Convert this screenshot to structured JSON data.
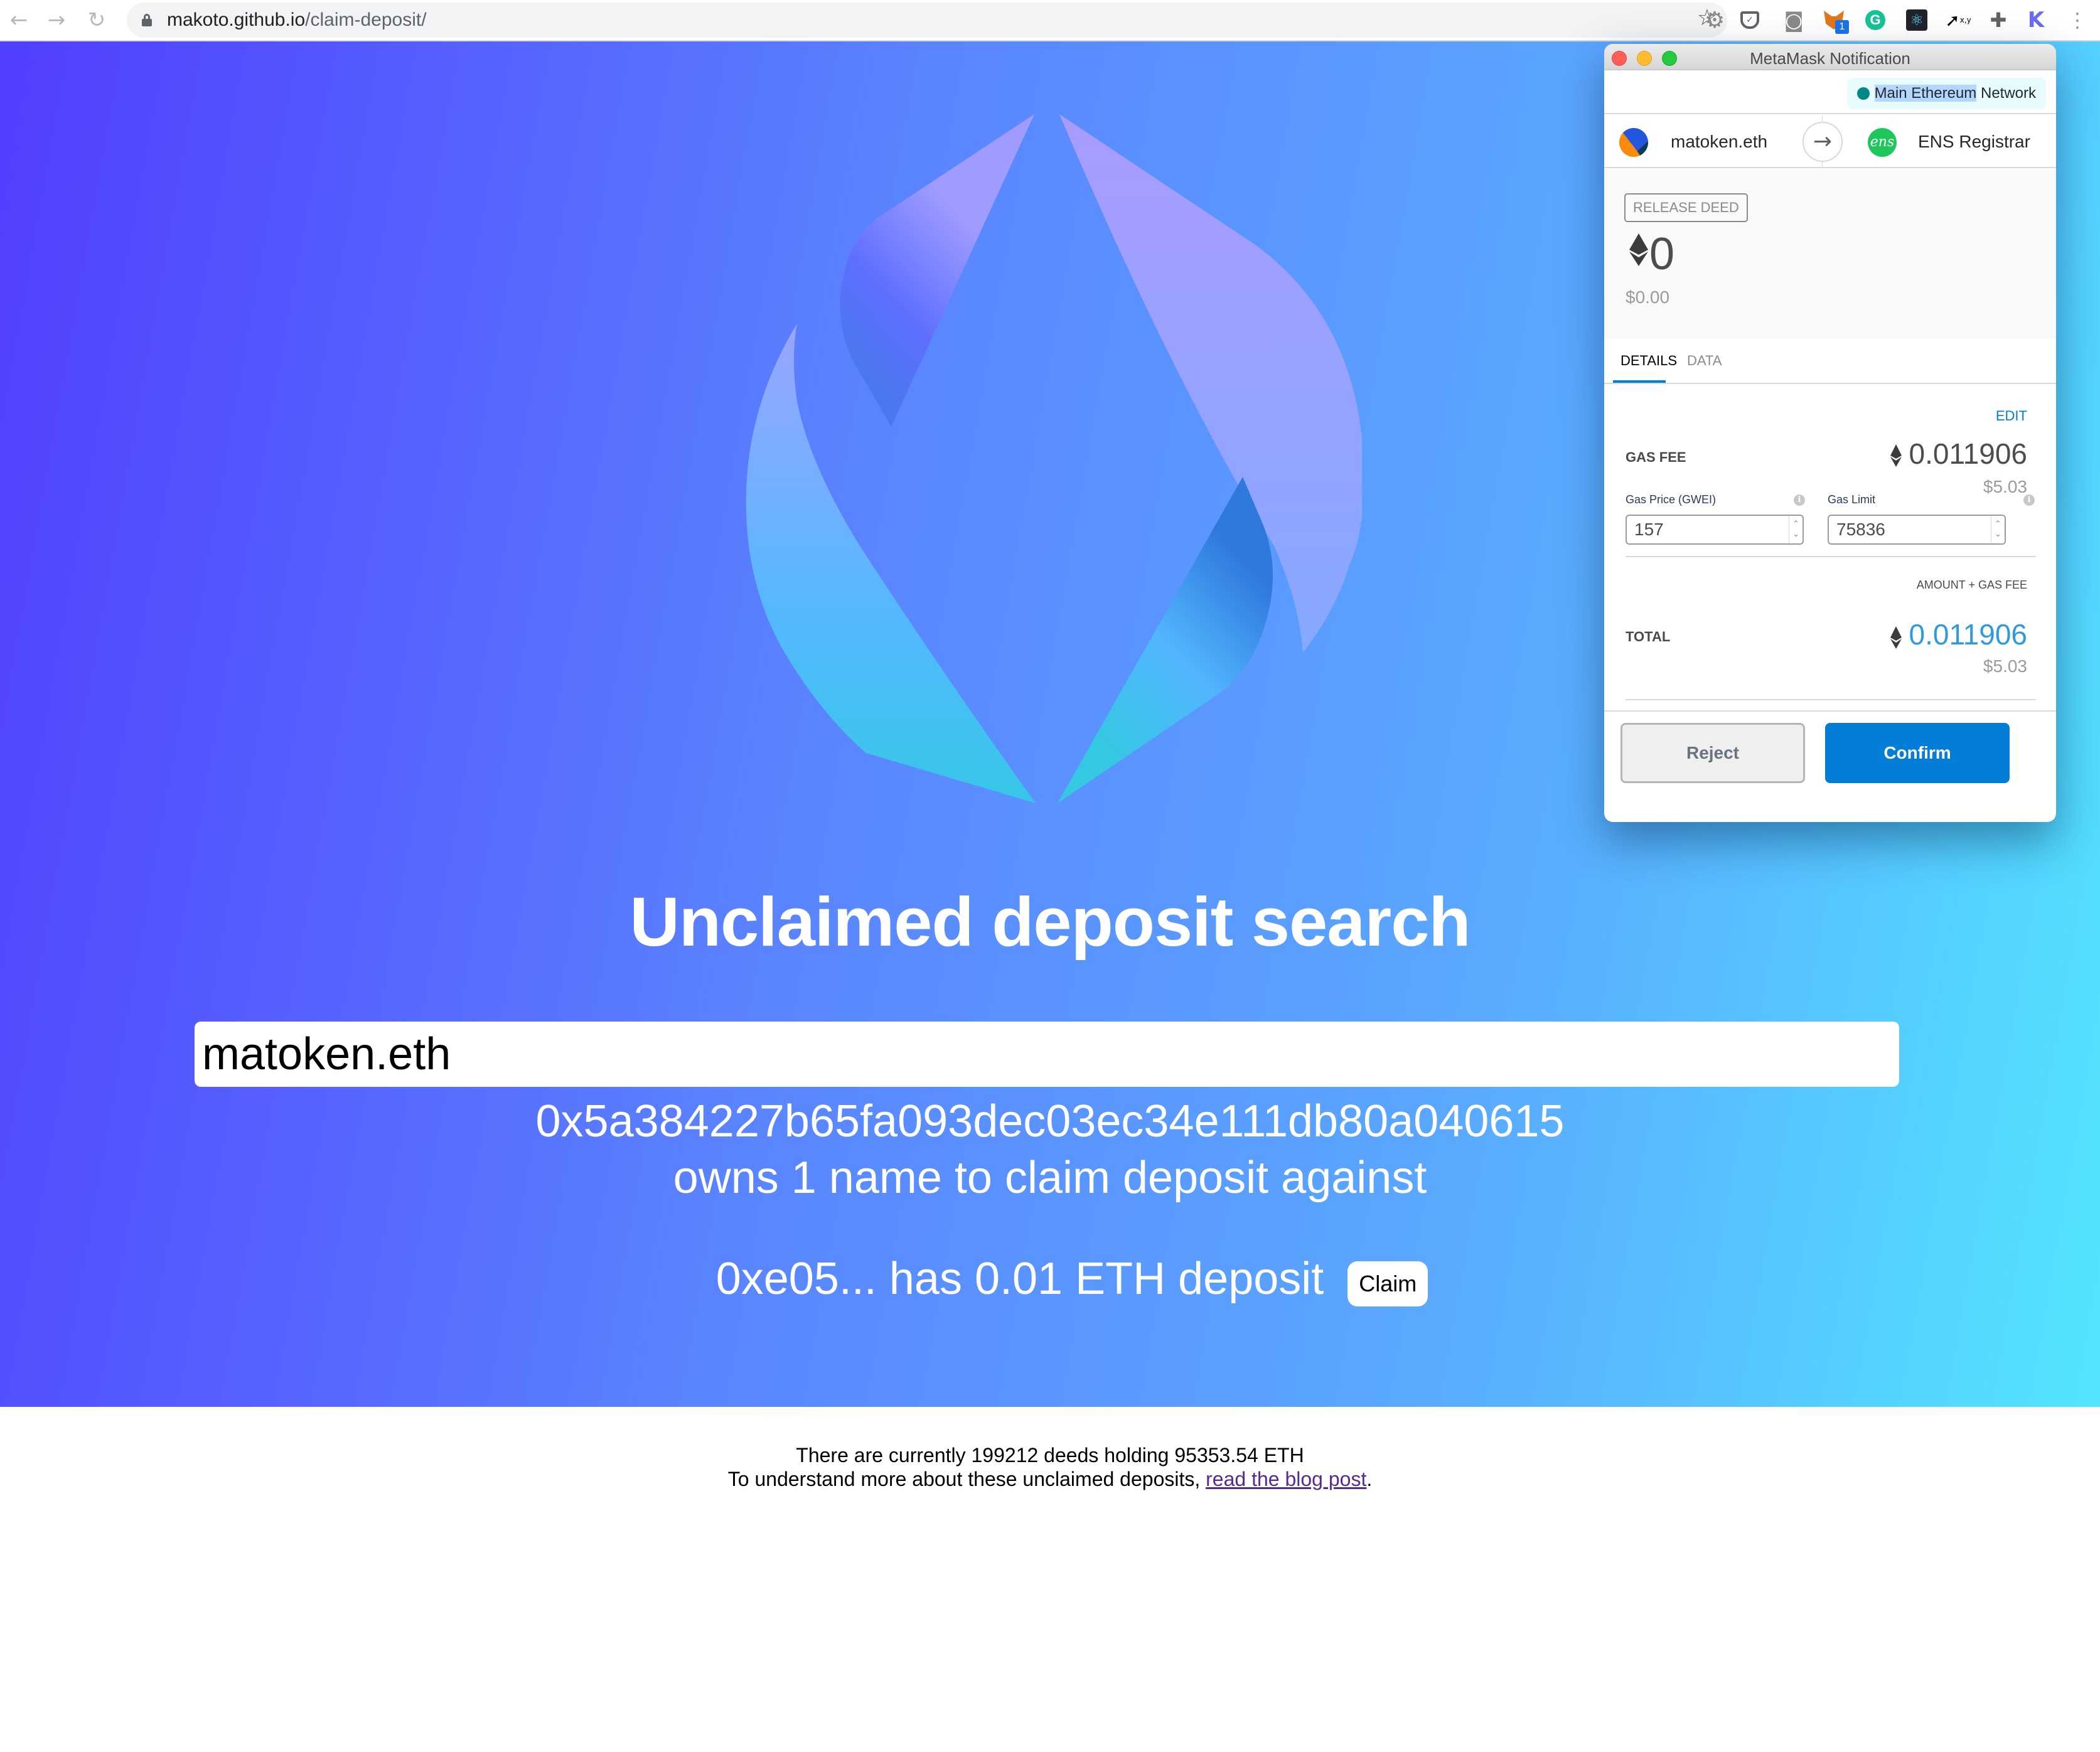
{
  "browser": {
    "url_host": "makoto.github.io",
    "url_path": "/claim-deposit/",
    "extensions": [
      {
        "name": "settings-gear",
        "icon": "⚙"
      },
      {
        "name": "pocket",
        "icon": "v"
      },
      {
        "name": "camera",
        "icon": "📷"
      },
      {
        "name": "metamask",
        "badge": "1"
      },
      {
        "name": "grammarly",
        "icon": "G"
      },
      {
        "name": "react-devtools",
        "icon": "⚛"
      },
      {
        "name": "cursor-xy",
        "icon": "x,y"
      },
      {
        "name": "extensions-puzzle",
        "icon": "✚"
      },
      {
        "name": "k-extension",
        "icon": "K"
      }
    ]
  },
  "page": {
    "title": "Unclaimed deposit search",
    "search_value": "matoken.eth",
    "owner_address": "0x5a384227b65fa093dec03ec34e111db80a040615",
    "owns_text": "owns 1 name to claim deposit against",
    "deposit_text": "0xe05... has 0.01 ETH deposit",
    "claim_label": "Claim",
    "colors": {
      "gradient_start": "#513eff",
      "gradient_end": "#52e5ff"
    }
  },
  "footer": {
    "stats_line": "There are currently 199212 deeds holding 95353.54 ETH",
    "info_prefix": "To understand more about these unclaimed deposits, ",
    "link_text": "read the blog post",
    "info_suffix": "."
  },
  "metamask": {
    "window_title": "MetaMask Notification",
    "network_highlighted": "Main Ethereum",
    "network_rest": " Network",
    "network_color": "#038789",
    "sender": "matoken.eth",
    "recipient": "ENS Registrar",
    "recipient_avatar_text": "ens",
    "method": "RELEASE DEED",
    "amount": "0",
    "amount_fiat": "$0.00",
    "tabs": [
      {
        "label": "DETAILS",
        "active": true
      },
      {
        "label": "DATA",
        "active": false
      }
    ],
    "edit_label": "EDIT",
    "gas_fee_label": "GAS FEE",
    "gas_fee_eth": "0.011906",
    "gas_fee_fiat": "$5.03",
    "gas_price_label": "Gas Price (GWEI)",
    "gas_price_value": "157",
    "gas_limit_label": "Gas Limit",
    "gas_limit_value": "75836",
    "amount_gas_label": "AMOUNT + GAS FEE",
    "total_label": "TOTAL",
    "total_eth": "0.011906",
    "total_fiat": "$5.03",
    "reject_label": "Reject",
    "confirm_label": "Confirm",
    "accent_color": "#037dd6"
  }
}
